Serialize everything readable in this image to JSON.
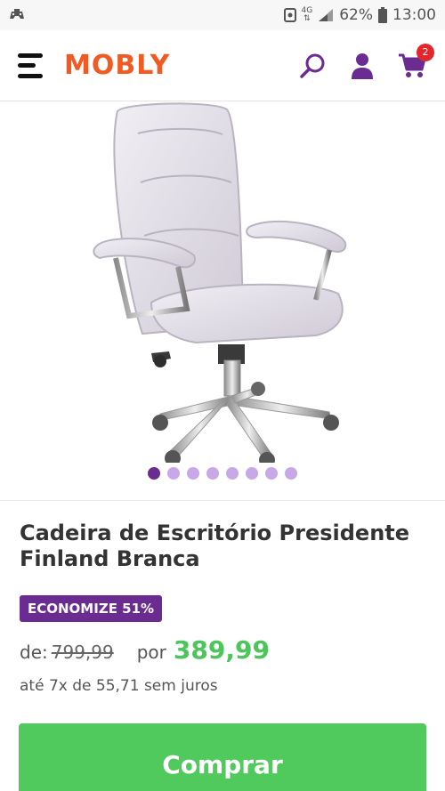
{
  "status_bar": {
    "app_icon": "game-controller-icon",
    "network": "4G",
    "battery_percent": "62%",
    "time": "13:00"
  },
  "header": {
    "logo": "MOBLY",
    "menu_icon": "hamburger-menu-icon",
    "search_icon": "search-icon",
    "account_icon": "user-icon",
    "cart_icon": "cart-icon",
    "cart_count": "2",
    "colors": {
      "logo": "#f15a22",
      "icons": "#6a2c91",
      "badge": "#e3262b"
    }
  },
  "gallery": {
    "image": "office-chair-image",
    "total_images": 8,
    "active_index": 0
  },
  "product": {
    "title": "Cadeira de Escritório Presidente Finland Branca",
    "discount": "ECONOMIZE 51%",
    "price_from_label": "de:",
    "price_old": "799,99",
    "price_to_label": "por",
    "price_new": "389,99",
    "installments": "até 7x de 55,71 sem juros",
    "colors": {
      "badge": "#6a2c91",
      "price": "#4cc55a",
      "button": "#50c95d"
    }
  },
  "actions": {
    "buy_label": "Comprar"
  }
}
